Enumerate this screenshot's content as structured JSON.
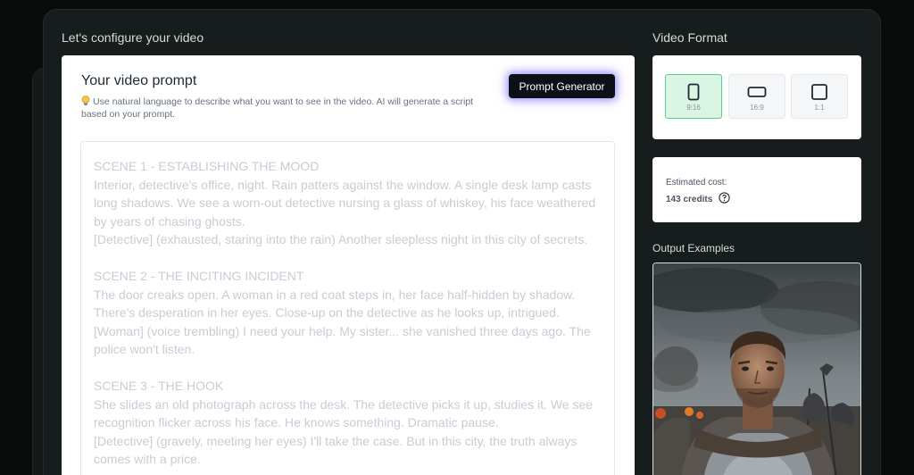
{
  "main": {
    "title": "Let's configure your video",
    "prompt_heading": "Your video prompt",
    "hint": "Use natural language to describe what you want to see in the video. AI will generate a script based on your prompt.",
    "generator_button": "Prompt Generator",
    "prompt_text": "SCENE 1 - ESTABLISHING THE MOOD\nInterior, detective's office, night. Rain patters against the window. A single desk lamp casts long shadows. We see a worn-out detective nursing a glass of whiskey, his face weathered by years of chasing ghosts.\n[Detective] (exhausted, staring into the rain) Another sleepless night in this city of secrets.\n\nSCENE 2 - THE INCITING INCIDENT\nThe door creaks open. A woman in a red coat steps in, her face half-hidden by shadow. There's desperation in her eyes. Close-up on the detective as he looks up, intrigued.\n[Woman] (voice trembling) I need your help. My sister... she vanished three days ago. The police won't listen.\n\nSCENE 3 - THE HOOK\nShe slides an old photograph across the desk. The detective picks it up, studies it. We see recognition flicker across his face. He knows something. Dramatic pause.\n[Detective] (gravely, meeting her eyes) I'll take the case. But in this city, the truth always comes with a price."
  },
  "format": {
    "title": "Video Format",
    "options": [
      {
        "label": "9:16",
        "selected": true,
        "icon": "portrait-icon"
      },
      {
        "label": "16:9",
        "selected": false,
        "icon": "landscape-icon"
      },
      {
        "label": "1:1",
        "selected": false,
        "icon": "square-icon"
      }
    ]
  },
  "cost": {
    "label": "Estimated cost:",
    "value": "143 credits"
  },
  "examples": {
    "title": "Output Examples"
  },
  "colors": {
    "accent_green": "#54d088",
    "background": "#0a0c0c",
    "panel": "#161d1c"
  }
}
